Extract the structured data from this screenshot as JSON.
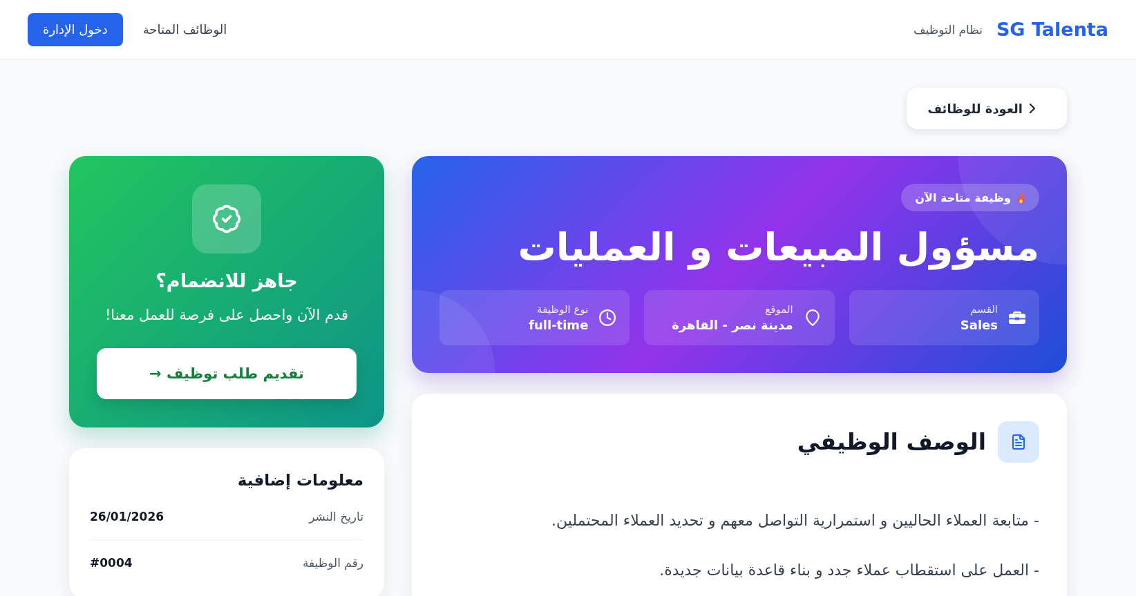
{
  "header": {
    "logo": "SG Talenta",
    "subtitle": "نظام التوظيف",
    "nav_link": "الوظائف المتاحة",
    "admin_button": "دخول الإدارة"
  },
  "back_button": "العودة للوظائف",
  "job": {
    "badge": "وظيفة متاحة الآن",
    "title": "مسؤول المبيعات و العمليات",
    "details": [
      {
        "kind": "department",
        "label": "القسم",
        "value": "Sales"
      },
      {
        "kind": "location",
        "label": "الموقع",
        "value": "مدينة نصر - القاهرة"
      },
      {
        "kind": "type",
        "label": "نوع الوظيفة",
        "value": "full-time"
      }
    ]
  },
  "description": {
    "title": "الوصف الوظيفي",
    "paragraphs": [
      "- متابعة العملاء الحاليين و استمرارية التواصل معهم و تحديد العملاء المحتملين.",
      "- العمل على استقطاب عملاء جدد و بناء قاعدة بيانات جديدة."
    ]
  },
  "apply_card": {
    "title": "جاهز للانضمام؟",
    "text": "قدم الآن واحصل على فرصة للعمل معنا!",
    "button": "تقديم طلب توظيف →"
  },
  "extra_info": {
    "title": "معلومات إضافية",
    "rows": [
      {
        "label": "تاريخ النشر",
        "value": "26/01/2026"
      },
      {
        "label": "رقم الوظيفة",
        "value": "#0004"
      }
    ]
  }
}
